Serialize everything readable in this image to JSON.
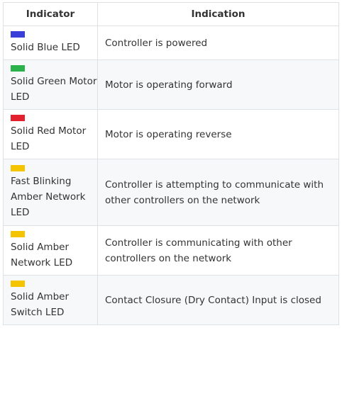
{
  "headers": {
    "indicator": "Indicator",
    "indication": "Indication"
  },
  "rows": [
    {
      "swatch_color": "#3b3fd9",
      "swatch_name": "blue-led-swatch-icon",
      "indicator": "Solid Blue LED",
      "indication": "Controller is powered"
    },
    {
      "swatch_color": "#2bb24c",
      "swatch_name": "green-led-swatch-icon",
      "indicator": "Solid Green Motor LED",
      "indication": "Motor is operating forward"
    },
    {
      "swatch_color": "#e3202e",
      "swatch_name": "red-led-swatch-icon",
      "indicator": "Solid Red Motor LED",
      "indication": "Motor is operating reverse"
    },
    {
      "swatch_color": "#f5c400",
      "swatch_name": "amber-led-swatch-icon",
      "indicator": "Fast Blinking Amber Network LED",
      "indication": "Controller is attempting to communicate with other controllers on the network"
    },
    {
      "swatch_color": "#f5c400",
      "swatch_name": "amber-led-swatch-icon",
      "indicator": "Solid Amber Network LED",
      "indication": "Controller is communicating with other controllers on the network"
    },
    {
      "swatch_color": "#f5c400",
      "swatch_name": "amber-led-swatch-icon",
      "indicator": "Solid Amber Switch LED",
      "indication": "Contact Closure (Dry Contact) Input is closed"
    }
  ]
}
